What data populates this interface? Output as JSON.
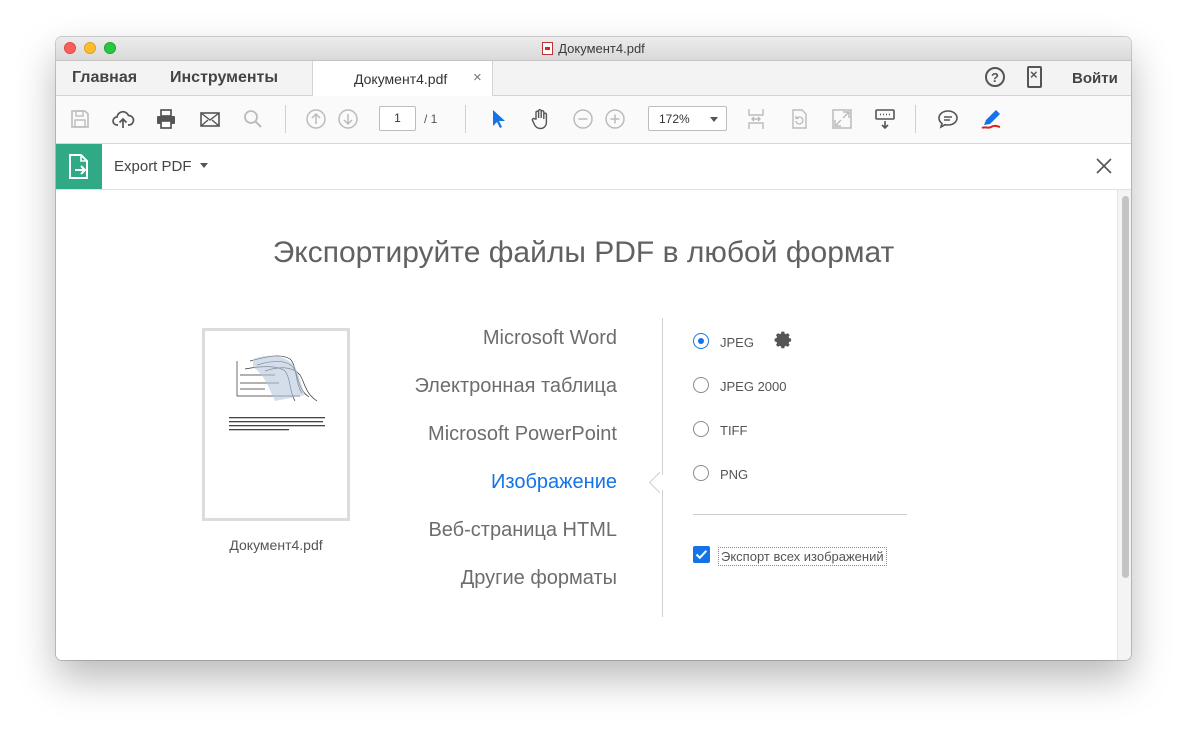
{
  "window": {
    "title": "Документ4.pdf"
  },
  "menubar": {
    "home": "Главная",
    "tools": "Инструменты",
    "tab_label": "Документ4.pdf",
    "tab_close": "×",
    "help": "?",
    "signin": "Войти"
  },
  "toolbar": {
    "page_current": "1",
    "page_total": "/ 1",
    "zoom": "172%",
    "icons": [
      "save-icon",
      "upload-cloud-icon",
      "print-icon",
      "email-icon",
      "search-icon",
      "page-up-icon",
      "page-down-icon",
      "select-arrow-icon",
      "hand-icon",
      "zoom-out-icon",
      "zoom-in-icon",
      "fit-width-icon",
      "rotate-page-icon",
      "fullscreen-icon",
      "read-mode-icon",
      "comment-icon",
      "sign-icon"
    ]
  },
  "export_bar": {
    "title": "Export PDF"
  },
  "main": {
    "heading": "Экспортируйте файлы PDF в любой формат",
    "thumbnail_label": "Документ4.pdf",
    "formats": [
      "Microsoft Word",
      "Электронная таблица",
      "Microsoft PowerPoint",
      "Изображение",
      "Веб-страница HTML",
      "Другие форматы"
    ],
    "active_format": "Изображение",
    "image_options": [
      "JPEG",
      "JPEG 2000",
      "TIFF",
      "PNG"
    ],
    "selected_option": "JPEG",
    "export_all_images": {
      "label": "Экспорт всех изображений",
      "checked": true
    }
  },
  "colors": {
    "accent": "#1473e6",
    "export_green": "#30a986",
    "text": "#6d6d6d"
  }
}
